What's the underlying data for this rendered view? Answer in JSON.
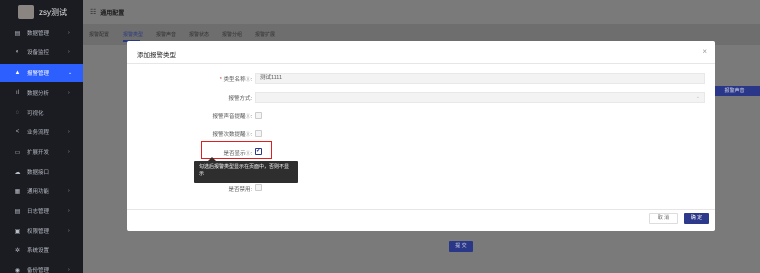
{
  "sidebar": {
    "brand": "zsy测试",
    "items": [
      {
        "label": "数据管理",
        "icon": "database-icon",
        "glyph": "▤",
        "arrow": "›",
        "active": false
      },
      {
        "label": "设备监控",
        "icon": "monitor-icon",
        "glyph": "◐",
        "arrow": "›",
        "active": false
      },
      {
        "label": "报警管理",
        "icon": "bell-icon",
        "glyph": "▲",
        "arrow": "⌄",
        "active": true
      },
      {
        "label": "数据分析",
        "icon": "bar-chart-icon",
        "glyph": "ıl",
        "arrow": "›",
        "active": false
      },
      {
        "label": "可视化",
        "icon": "eye-icon",
        "glyph": "◌",
        "arrow": "",
        "active": false
      },
      {
        "label": "业务流程",
        "icon": "share-icon",
        "glyph": "<",
        "arrow": "›",
        "active": false
      },
      {
        "label": "扩展开发",
        "icon": "code-icon",
        "glyph": "▭",
        "arrow": "›",
        "active": false
      },
      {
        "label": "数据接口",
        "icon": "cloud-icon",
        "glyph": "☁",
        "arrow": "",
        "active": false
      },
      {
        "label": "通用功能",
        "icon": "grid-icon",
        "glyph": "▦",
        "arrow": "›",
        "active": false
      },
      {
        "label": "日志管理",
        "icon": "log-icon",
        "glyph": "▤",
        "arrow": "›",
        "active": false
      },
      {
        "label": "权限管理",
        "icon": "lock-icon",
        "glyph": "▣",
        "arrow": "›",
        "active": false
      },
      {
        "label": "系统设置",
        "icon": "gear-icon",
        "glyph": "✲",
        "arrow": "",
        "active": false
      },
      {
        "label": "备份管理",
        "icon": "backup-icon",
        "glyph": "◉",
        "arrow": "›",
        "active": false
      }
    ]
  },
  "header": {
    "title_icon": "settings-icon",
    "title_glyph": "☷",
    "title": "通用配置"
  },
  "tabs": [
    "报警配置",
    "报警类型",
    "报警声音",
    "报警状态",
    "报警分组",
    "报警扩展"
  ],
  "active_tab": "报警类型",
  "background": {
    "alarm_sound_button": "报警声音",
    "submit_button": "提 交"
  },
  "modal": {
    "title": "添加报警类型",
    "close_glyph": "×",
    "fields": {
      "type_name": {
        "label": "类型名称",
        "value": "测试1111",
        "required": true
      },
      "alarm_method": {
        "label": "报警方式:",
        "value": ""
      },
      "sound_reminder": {
        "label": "报警声音提醒",
        "checked": false
      },
      "count_reminder": {
        "label": "报警次数提醒",
        "checked": false
      },
      "show": {
        "label": "是否显示",
        "checked": true
      },
      "disabled": {
        "label": "是否禁用:",
        "checked": false
      }
    },
    "help_glyph": "⓪",
    "colon": ":",
    "check_glyph": "✓",
    "chevron_glyph": "⌄",
    "tooltip": "勾选后报警类型显示在页面中，否则不显示",
    "cancel": "取 消",
    "confirm": "确 定"
  },
  "colors": {
    "sidebar_bg": "#1b1c22",
    "active_nav": "#2d5fff",
    "primary": "#2d3a8c",
    "highlight": "#e02020"
  }
}
